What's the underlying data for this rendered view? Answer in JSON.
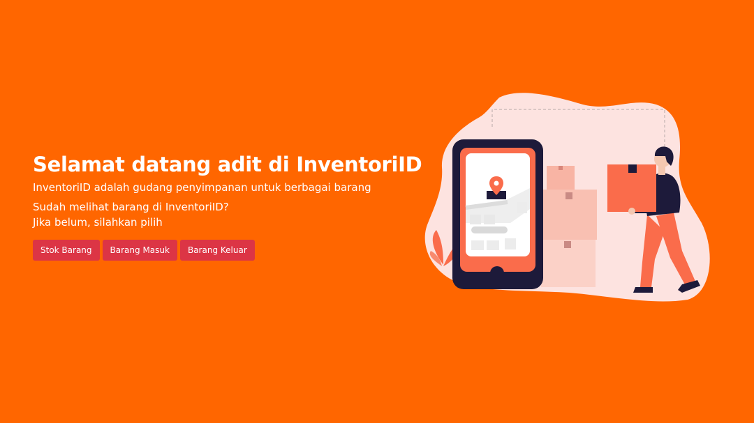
{
  "hero": {
    "title": "Selamat datang adit di InventoriID",
    "description": "InventoriID adalah gudang penyimpanan untuk berbagai barang",
    "question": "Sudah melihat barang di InventoriID?",
    "prompt": "Jika belum, silahkan pilih"
  },
  "buttons": {
    "stock": "Stok Barang",
    "incoming": "Barang Masuk",
    "outgoing": "Barang Keluar"
  },
  "colors": {
    "background": "#ff6600",
    "button": "#dc3545",
    "illustration_accent": "#fa6c4b",
    "illustration_dark": "#1d1a3a",
    "illustration_blob": "#fde3e0"
  },
  "illustration": {
    "icons": [
      "smartphone-icon",
      "map-pin-icon",
      "box-icon",
      "person-carrying-box-icon",
      "plant-icon"
    ]
  }
}
